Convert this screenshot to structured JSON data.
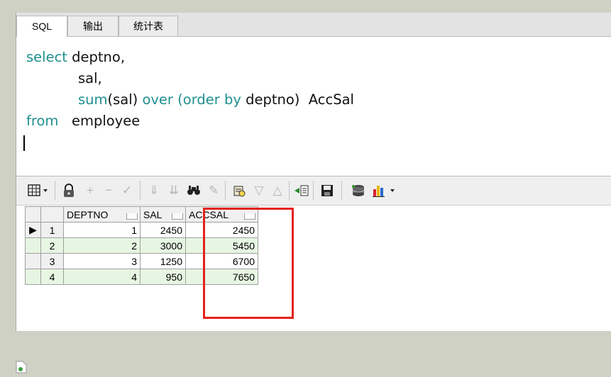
{
  "tabs": [
    {
      "label": "SQL",
      "active": true
    },
    {
      "label": "输出",
      "active": false
    },
    {
      "label": "统计表",
      "active": false
    }
  ],
  "editor": {
    "line1_kw": "select",
    "line1_id": " deptno,",
    "line2_id": "sal,",
    "line3_fn": "sum",
    "line3_arg": "(sal)",
    "line3_kw1": " over ",
    "line3_kw2": "(order by",
    "line3_id": " deptno)  AccSal",
    "line4_kw": "from",
    "line4_id": "   employee"
  },
  "toolbar": {
    "icons": [
      "grid-options-icon",
      "lock-icon",
      "add-icon",
      "remove-icon",
      "check-icon",
      "filter-icon",
      "filter-clear-icon",
      "find-icon",
      "pen-icon",
      "query-icon",
      "sort-down-icon",
      "sort-up-icon",
      "export-icon",
      "save-icon",
      "db-icon",
      "chart-icon"
    ]
  },
  "grid": {
    "columns": [
      "DEPTNO",
      "SAL",
      "ACCSAL"
    ],
    "rows": [
      {
        "n": "1",
        "deptno": "1",
        "sal": "2450",
        "accsal": "2450"
      },
      {
        "n": "2",
        "deptno": "2",
        "sal": "3000",
        "accsal": "5450"
      },
      {
        "n": "3",
        "deptno": "3",
        "sal": "1250",
        "accsal": "6700"
      },
      {
        "n": "4",
        "deptno": "4",
        "sal": "950",
        "accsal": "7650"
      }
    ],
    "current_row_marker": "▶"
  },
  "colors": {
    "keyword": "#1f8f8f",
    "highlight": "#e4211b",
    "alt_row": "#e7f6e2"
  }
}
